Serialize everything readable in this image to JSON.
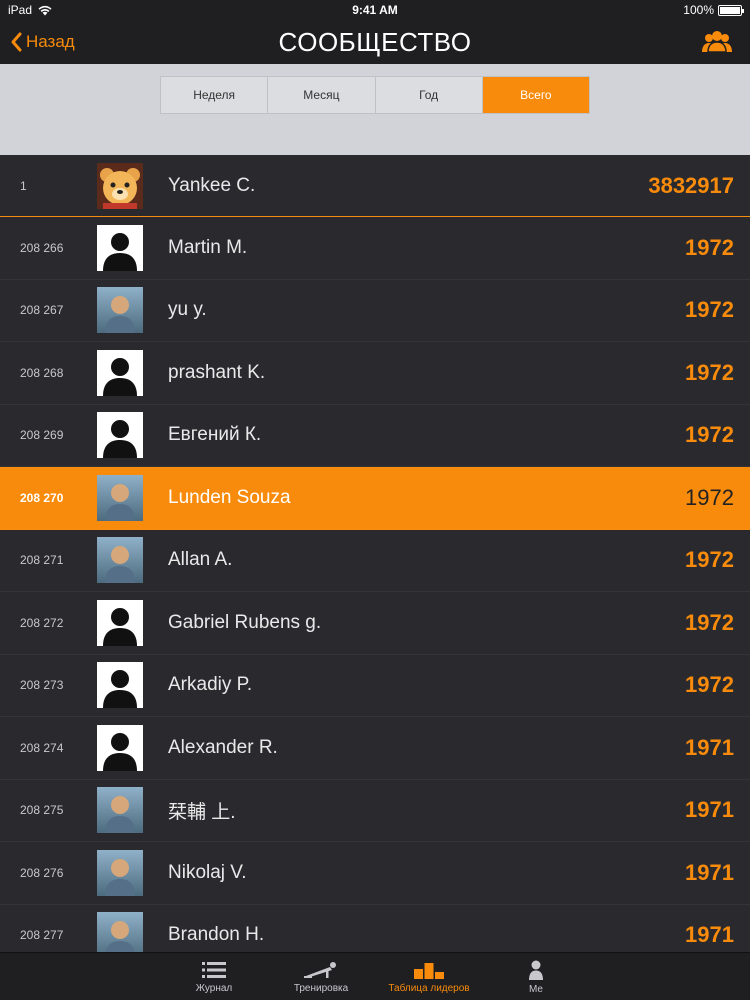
{
  "status_bar": {
    "device": "iPad",
    "time": "9:41 AM",
    "battery": "100%",
    "battery_level": 1.0
  },
  "nav": {
    "back_label": "Назад",
    "title": "СООБЩЕСТВО"
  },
  "segments": [
    {
      "label": "Неделя",
      "active": false
    },
    {
      "label": "Месяц",
      "active": false
    },
    {
      "label": "Год",
      "active": false
    },
    {
      "label": "Всего",
      "active": true
    }
  ],
  "leaderboard": [
    {
      "rank": "1",
      "name": "Yankee C.",
      "score": "3832917",
      "avatar": "bear-avatar"
    },
    {
      "rank": "208 266",
      "name": "Martin M.",
      "score": "1972",
      "avatar": "default-avatar"
    },
    {
      "rank": "208 267",
      "name": "yu y.",
      "score": "1972",
      "avatar": "photo-avatar"
    },
    {
      "rank": "208 268",
      "name": "prashant K.",
      "score": "1972",
      "avatar": "default-avatar"
    },
    {
      "rank": "208 269",
      "name": "Евгений К.",
      "score": "1972",
      "avatar": "default-avatar"
    },
    {
      "rank": "208 270",
      "name": "Lunden Souza",
      "score": "1972",
      "avatar": "photo-avatar",
      "highlight": true
    },
    {
      "rank": "208 271",
      "name": "Allan A.",
      "score": "1972",
      "avatar": "photo-avatar"
    },
    {
      "rank": "208 272",
      "name": "Gabriel Rubens g.",
      "score": "1972",
      "avatar": "default-avatar"
    },
    {
      "rank": "208 273",
      "name": "Arkadiy P.",
      "score": "1972",
      "avatar": "default-avatar"
    },
    {
      "rank": "208 274",
      "name": "Alexander R.",
      "score": "1971",
      "avatar": "default-avatar"
    },
    {
      "rank": "208 275",
      "name": "栞輔 上.",
      "score": "1971",
      "avatar": "photo-avatar"
    },
    {
      "rank": "208 276",
      "name": "Nikolaj V.",
      "score": "1971",
      "avatar": "photo-avatar"
    },
    {
      "rank": "208 277",
      "name": "Brandon H.",
      "score": "1971",
      "avatar": "photo-avatar"
    }
  ],
  "tabs": [
    {
      "label": "Журнал",
      "icon": "list-icon",
      "active": false
    },
    {
      "label": "Тренировка",
      "icon": "pushup-icon",
      "active": false
    },
    {
      "label": "Таблица лидеров",
      "icon": "podium-icon",
      "active": true
    },
    {
      "label": "Me",
      "icon": "person-icon",
      "active": false
    }
  ],
  "colors": {
    "accent": "#f88b0b",
    "background": "#2a2a2e",
    "bar": "#1f1f22"
  }
}
